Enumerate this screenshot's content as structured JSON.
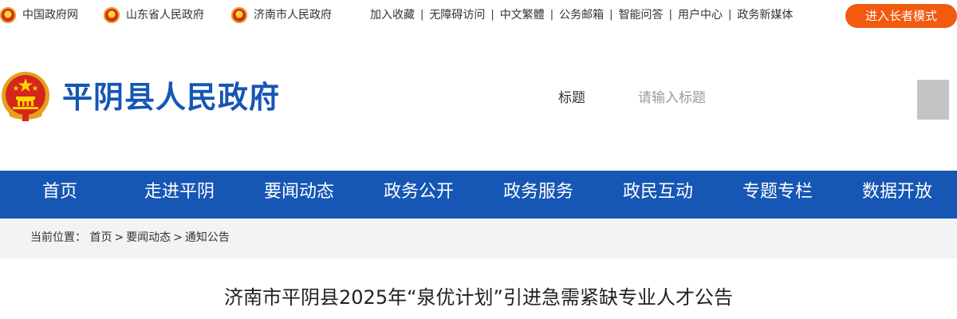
{
  "topbar": {
    "gov_links": [
      {
        "label": "中国政府网",
        "icon": "national-emblem-icon"
      },
      {
        "label": "山东省人民政府",
        "icon": "national-emblem-icon"
      },
      {
        "label": "济南市人民政府",
        "icon": "national-emblem-icon"
      }
    ],
    "utilities": [
      "加入收藏",
      "无障碍访问",
      "中文繁體",
      "公务邮箱",
      "智能问答",
      "用户中心",
      "政务新媒体"
    ],
    "separator": "|",
    "elder_mode_label": "进入长者模式"
  },
  "header": {
    "site_title": "平阴县人民政府",
    "search_label": "标题",
    "search_placeholder": "请输入标题",
    "search_value": ""
  },
  "nav": {
    "items": [
      "首页",
      "走进平阴",
      "要闻动态",
      "政务公开",
      "政务服务",
      "政民互动",
      "专题专栏",
      "数据开放"
    ]
  },
  "breadcrumb": {
    "prefix": "当前位置：",
    "items": [
      "首页",
      "要闻动态",
      "通知公告"
    ],
    "separator": ">"
  },
  "article": {
    "title": "济南市平阴县2025年“泉优计划”引进急需紧缺专业人才公告"
  },
  "colors": {
    "brand_blue": "#1656b4",
    "elder_button": "#f25a0f",
    "breadcrumb_bg": "#f3f3f3",
    "search_button": "#c4c4c4"
  }
}
